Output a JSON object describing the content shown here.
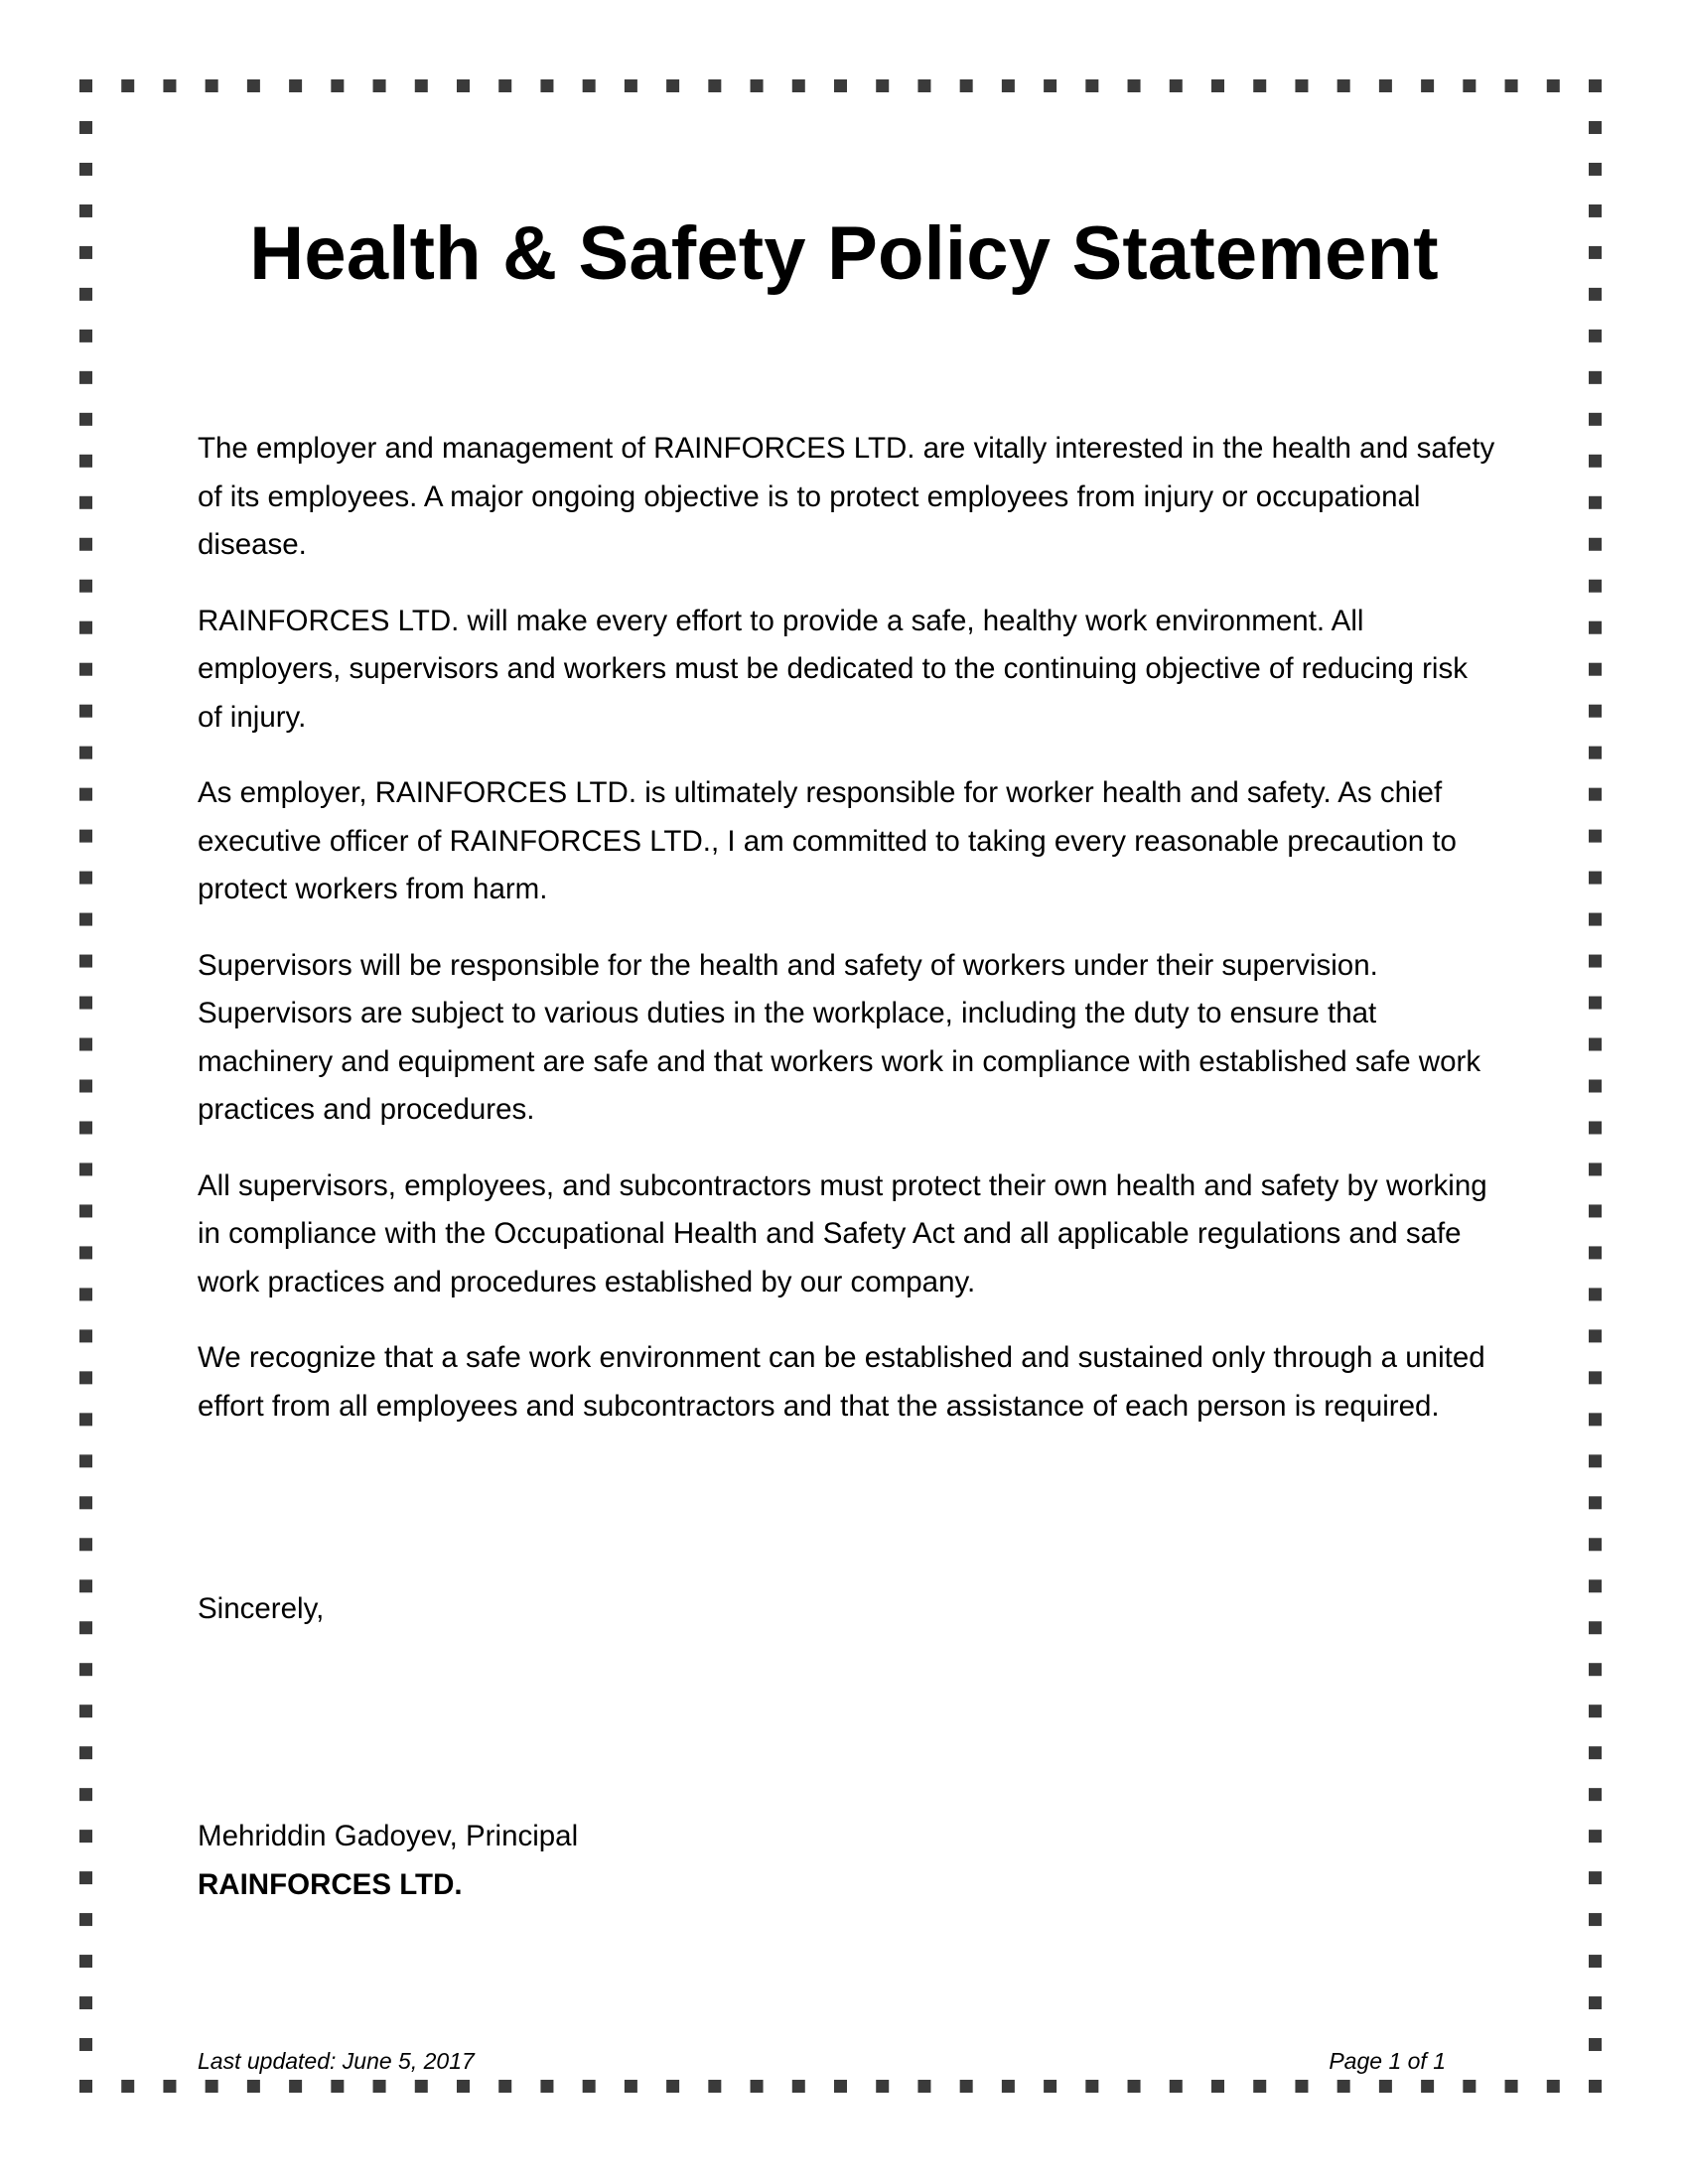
{
  "document": {
    "title": "Health & Safety Policy Statement",
    "paragraphs": [
      "The employer and management of RAINFORCES LTD.  are vitally interested in the health and safety of its employees. A major ongoing objective is to protect employees from injury or occupational disease.",
      "RAINFORCES LTD. will make every effort to provide a safe, healthy work environment. All employers, supervisors and workers must be dedicated to the continuing objective of reducing risk of injury.",
      "As employer, RAINFORCES LTD. is ultimately responsible for worker health and safety.  As chief executive officer of RAINFORCES LTD., I am committed to taking every reasonable precaution to protect workers from harm.",
      "Supervisors will be responsible for the health and safety of workers under their supervision. Supervisors are subject to various duties in the workplace, including the duty to ensure that machinery and equipment are safe and that workers work in compliance with established safe work practices and procedures.",
      "All supervisors, employees, and subcontractors must protect their own health and safety by working in compliance with the Occupational Health and Safety Act and all applicable regulations and safe work practices and procedures established by our company.",
      "We recognize that a safe work environment can be established and sustained only through a united effort from all employees and subcontractors and that the assistance of each person is required."
    ],
    "closing": "Sincerely,",
    "signer": "Mehriddin Gadoyev, Principal",
    "company": "RAINFORCES LTD."
  },
  "footer": {
    "last_updated": "Last updated: June 5, 2017",
    "page_number": "Page 1 of 1"
  },
  "style": {
    "border_color": "#3a3a3a",
    "text_color": "#000000",
    "background": "#ffffff"
  }
}
